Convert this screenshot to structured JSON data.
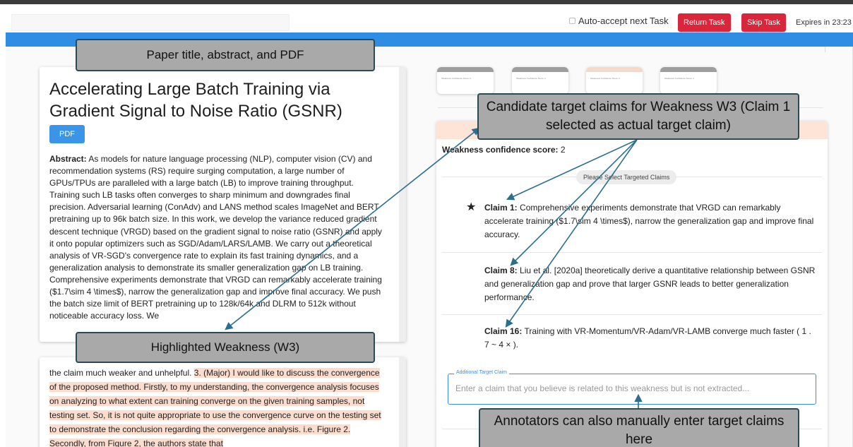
{
  "header": {
    "auto_accept_label": "Auto-accept next Task",
    "return_task_label": "Return Task",
    "skip_task_label": "Skip Task",
    "expires_label": "Expires in 23:23"
  },
  "paper": {
    "title": "Accelerating Large Batch Training via Gradient Signal to Noise Ratio (GSNR)",
    "pdf_label": "PDF",
    "abstract_label": "Abstract:",
    "abstract_text": "As models for nature language processing (NLP), computer vision (CV) and recommendation systems (RS) require surging computation, a large number of GPUs/TPUs are paralleled with a large batch (LB) to improve training throughput. Training such LB tasks often converges to sharp minimum and downgrades final precision. Adversarial learning (ConAdv) and LANS method scales ImageNet and BERT pretraining up to 96k batch size. In this work, we develop the variance reduced gradient descent technique (VRGD) based on the gradient signal to noise ratio (GSNR) and apply it onto popular optimizers such as SGD/Adam/LARS/LAMB. We carry out a theoretical analysis of VR-SGD's convergence rate to explain its fast training dynamics, and a generalization analysis to demonstrate its smaller generalization gap on LB training. Comprehensive experiments demonstrate that VRGD can remarkably accelerate training ($1.7\\sim 4 \\times$), narrow the generalization gap and improve final accuracy. We push the batch size limit of BERT pretraining up to 128k/64k and DLRM to 512k without noticeable accuracy loss. We"
  },
  "weakness": {
    "text_before": "the claim much weaker and unhelpful. ",
    "text_highlighted": "3. (Major) I would like to discuss the convergence of the proposed method. Firstly, to my understanding, the convergence analysis focuses on analyzing to what extent can training converge on the given training samples, not testing set. So, it is not quite appropriate to use the convergence curve on the testing set to demonstrate the conclusion regarding the convergence analysis. i.e. Figure 2. Secondly, from Figure 2, the authors state that"
  },
  "tabs": [
    {
      "label": "Weakness Confidence Score: 2"
    },
    {
      "label": "Weakness Confidence Score: 2"
    },
    {
      "label": "Weakness Confidence Score: 2"
    },
    {
      "label": "Weakness Confidence Score: 2"
    }
  ],
  "panel": {
    "confidence_label": "Weakness confidence score:",
    "confidence_value": "2",
    "select_claims_label": "Please Select Targeted Claims",
    "claims": [
      {
        "label": "Claim 1:",
        "text": "Comprehensive experiments demonstrate that VRGD can remarkably accelerate training ($1.7\\sim 4 \\times$), narrow the generalization gap and improve final accuracy."
      },
      {
        "label": "Claim 8:",
        "text": "Liu et al. [2020a] theoretically derive a quantitative relationship between GSNR and generalization gap and prove that larger GSNR leads to better generalization performance."
      },
      {
        "label": "Claim 16:",
        "text": "Training with VR-Momentum/VR-Adam/VR-LAMB converge much faster ( 1 . 7 ~ 4 × )."
      }
    ],
    "additional_legend": "Additional Target Claim",
    "additional_placeholder": "Enter a claim that you believe is related to this weakness but is not extracted..."
  },
  "callouts": {
    "paper": "Paper title, abstract, and PDF",
    "weakness": "Highlighted Weakness (W3)",
    "candidates": "Candidate target claims for Weakness W3 (Claim 1 selected as actual target claim)",
    "manual": "Annotators can also manually enter target claims here"
  },
  "colors": {
    "accent_blue": "#2f8de4",
    "button_red": "#d9263a",
    "highlight": "#fbdccd",
    "callout_fill": "#a9a9a9",
    "arrow": "#2a6f8c"
  }
}
